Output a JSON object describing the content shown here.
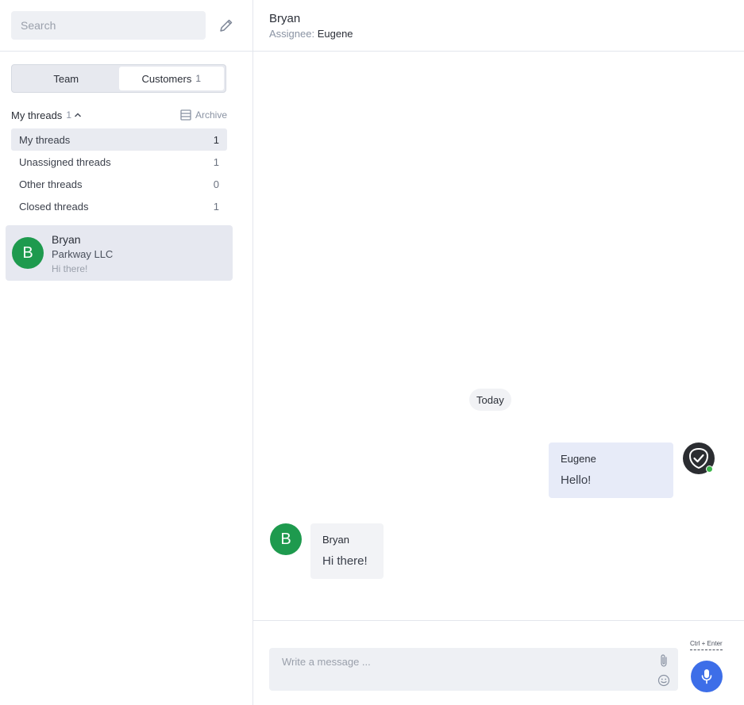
{
  "sidebar": {
    "search": {
      "placeholder": "Search",
      "value": ""
    },
    "compose_icon": "pencil-icon",
    "tabs": [
      {
        "label": "Team",
        "count": ""
      },
      {
        "label": "Customers",
        "count": "1"
      }
    ],
    "threads_header": {
      "title": "My threads",
      "count": "1",
      "archive_label": "Archive"
    },
    "filters": [
      {
        "label": "My threads",
        "count": "1",
        "active": true
      },
      {
        "label": "Unassigned threads",
        "count": "1"
      },
      {
        "label": "Other threads",
        "count": "0"
      },
      {
        "label": "Closed threads",
        "count": "1"
      }
    ],
    "conversations": [
      {
        "initial": "B",
        "name": "Bryan",
        "company": "Parkway LLC",
        "preview": "Hi there!"
      }
    ]
  },
  "main": {
    "header": {
      "name": "Bryan",
      "assignee_label": "Assignee:",
      "assignee": "Eugene"
    },
    "date_separator": "Today",
    "messages": [
      {
        "direction": "outgoing",
        "sender": "Eugene",
        "text": "Hello!"
      },
      {
        "direction": "incoming",
        "initial": "B",
        "sender": "Bryan",
        "text": "Hi there!"
      }
    ],
    "composer": {
      "placeholder": "Write a message ...",
      "value": "",
      "hint": "Ctrl + Enter"
    }
  },
  "colors": {
    "avatar_green": "#1e9a4e",
    "accent_blue": "#3d6ee8",
    "online_green": "#3cb54a",
    "outgoing_bubble": "#e7ebf8",
    "incoming_bubble": "#f2f3f6"
  }
}
